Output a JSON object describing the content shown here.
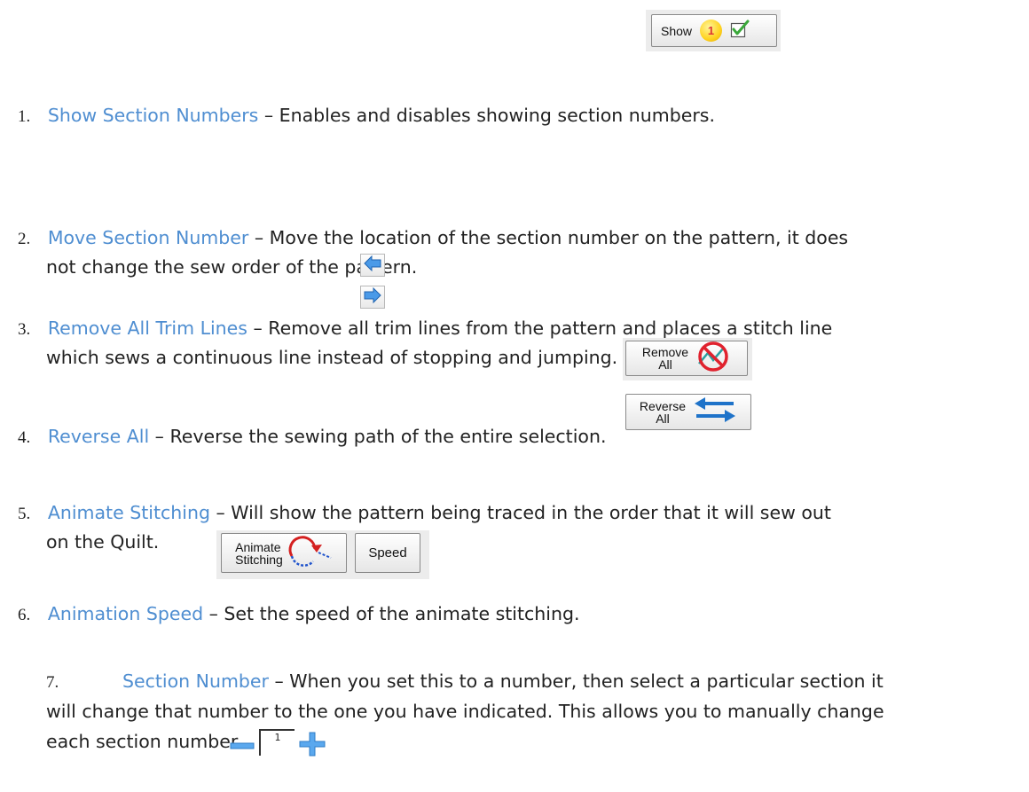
{
  "items": [
    {
      "num": "1.",
      "title": "Show Section Numbers",
      "dash": " – ",
      "desc": "Enables and disables showing section numbers."
    },
    {
      "num": "2.",
      "title": "Move Section Number",
      "dash": " – ",
      "desc": "Move the location of the section number on the pattern, it does",
      "desc2": "not change the sew order of the pattern."
    },
    {
      "num": "3.",
      "title": "Remove All Trim Lines",
      "dash": " – ",
      "desc": "Remove all trim lines from the pattern and places a stitch line",
      "desc2": "which sews a continuous line instead of stopping and jumping."
    },
    {
      "num": "4.",
      "title": "Reverse All",
      "dash": " – ",
      "desc": "Reverse the sewing path of the entire selection."
    },
    {
      "num": "5.",
      "title": "Animate Stitching",
      "dash": " – ",
      "desc": "Will show the pattern being traced in the order that it will sew out",
      "desc2": "on the Quilt."
    },
    {
      "num": "6.",
      "title": "Animation Speed",
      "dash": " – ",
      "desc": "Set the speed of the animate stitching."
    },
    {
      "num": "7.",
      "title": "Section Number",
      "dash": " – ",
      "desc": "When you set this to a number, then select a particular section it",
      "desc2": "will change that number to the one you have indicated. This allows you to manually change",
      "desc3": "each section number."
    }
  ],
  "buttons": {
    "show_label": "Show",
    "show_badge": "1",
    "remove_line1": "Remove",
    "remove_line2": "All",
    "reverse_line1": "Reverse",
    "reverse_line2": "All",
    "animate_line1": "Animate",
    "animate_line2": "Stitching",
    "speed_label": "Speed",
    "stepper_value": "1"
  },
  "colors": {
    "title": "#4f8ed1",
    "badge": "#ffd21f",
    "arrow_blue": "#1f73c9",
    "no_red": "#e0222e"
  },
  "icons": [
    "checkbox-checked-icon",
    "arrow-left-icon",
    "arrow-right-icon",
    "no-trim-icon",
    "swap-arrows-icon",
    "curved-arrow-icon",
    "minus-icon",
    "plus-icon"
  ]
}
